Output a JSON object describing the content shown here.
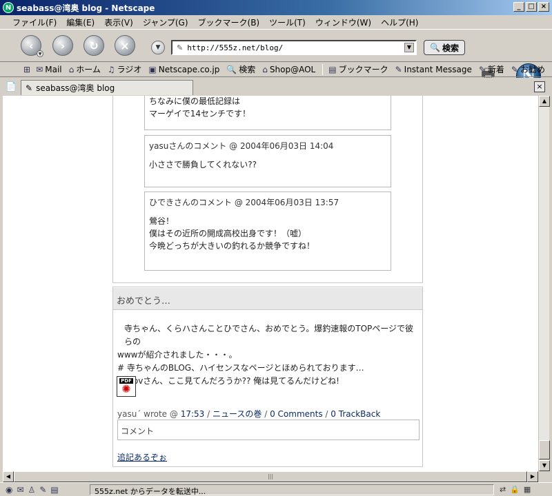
{
  "window": {
    "title": "seabass@湾奥 blog - Netscape"
  },
  "menubar": [
    "ファイル(F)",
    "編集(E)",
    "表示(V)",
    "ジャンプ(G)",
    "ブックマーク(B)",
    "ツール(T)",
    "ウィンドウ(W)",
    "ヘルプ(H)"
  ],
  "navbar": {
    "url": "http://555z.net/blog/",
    "search_label": "検索"
  },
  "personal_toolbar": {
    "items": [
      {
        "label": "Mail",
        "icon": "mail-icon"
      },
      {
        "label": "ホーム",
        "icon": "home-icon"
      },
      {
        "label": "ラジオ",
        "icon": "radio-icon"
      },
      {
        "label": "Netscape.co.jp",
        "icon": "netscape-icon"
      },
      {
        "label": "検索",
        "icon": "search-icon"
      },
      {
        "label": "Shop@AOL",
        "icon": "shop-icon"
      },
      {
        "label": "ブックマーク",
        "icon": "bookmark-icon"
      },
      {
        "label": "Instant Message",
        "icon": "im-icon"
      },
      {
        "label": "新着",
        "icon": "new-icon"
      },
      {
        "label": "お勧め",
        "icon": "recommend-icon"
      }
    ]
  },
  "tab": {
    "label": "seabass@湾奥 blog"
  },
  "comments": [
    {
      "meta": "",
      "body_lines": [
        "ちなみに僕の最低記録は",
        "マーゲイで14センチです！"
      ]
    },
    {
      "meta": "yasuさんのコメント @ 2004年06月03日 14:04",
      "body_lines": [
        "小ささで勝負してくれない??"
      ]
    },
    {
      "meta": "ひできさんのコメント @ 2004年06月03日 13:57",
      "body_lines": [
        "鶯谷！",
        "僕はその近所の開成高校出身です！（嘘）",
        "今晩どっちが大きいの釣れるか競争ですね！"
      ]
    }
  ],
  "entry": {
    "title": "おめでとう…",
    "body_lines": [
      "寺ちゃん、くらハさんことひでさん、おめでとう。爆釣速報のTOPページで彼らの",
      "wwwが紹介されました・・・。",
      "# 寺ちゃんのBLOG、ハイセンスなページとほめられております…",
      "# Novさん、ここ見てんだろうか?? 俺は見てるんだけどね!"
    ],
    "pdf_label": "PDF",
    "footer": {
      "author": "yasu´ wrote @",
      "time": "17:53",
      "category": "ニュースの巻",
      "comments": "0 Comments",
      "trackback": "0 TrackBack",
      "sep": "/"
    },
    "comment_field_label": "コメント",
    "addendum": "追記あるぞぉ"
  },
  "statusbar": {
    "text": "555z.net からデータを転送中..."
  }
}
